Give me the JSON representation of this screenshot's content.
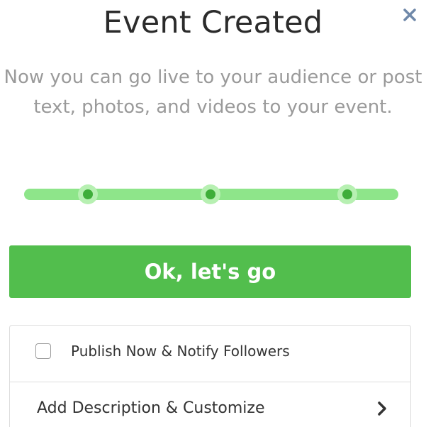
{
  "modal": {
    "title": "Event Created",
    "close_icon": "close-icon",
    "description": "Now you can go live to your audience or post text, photos, and videos to your event.",
    "progress": {
      "steps_total": 3,
      "steps_completed": 3,
      "color": "#7fd879",
      "dot_color": "#3fae3a"
    },
    "cta_label": "Ok, let's go",
    "cta_color": "#52be4d",
    "options": {
      "publish_label": "Publish Now & Notify Followers",
      "publish_checked": false,
      "customize_label": "Add Description & Customize",
      "customize_icon": "chevron-right-icon"
    }
  }
}
